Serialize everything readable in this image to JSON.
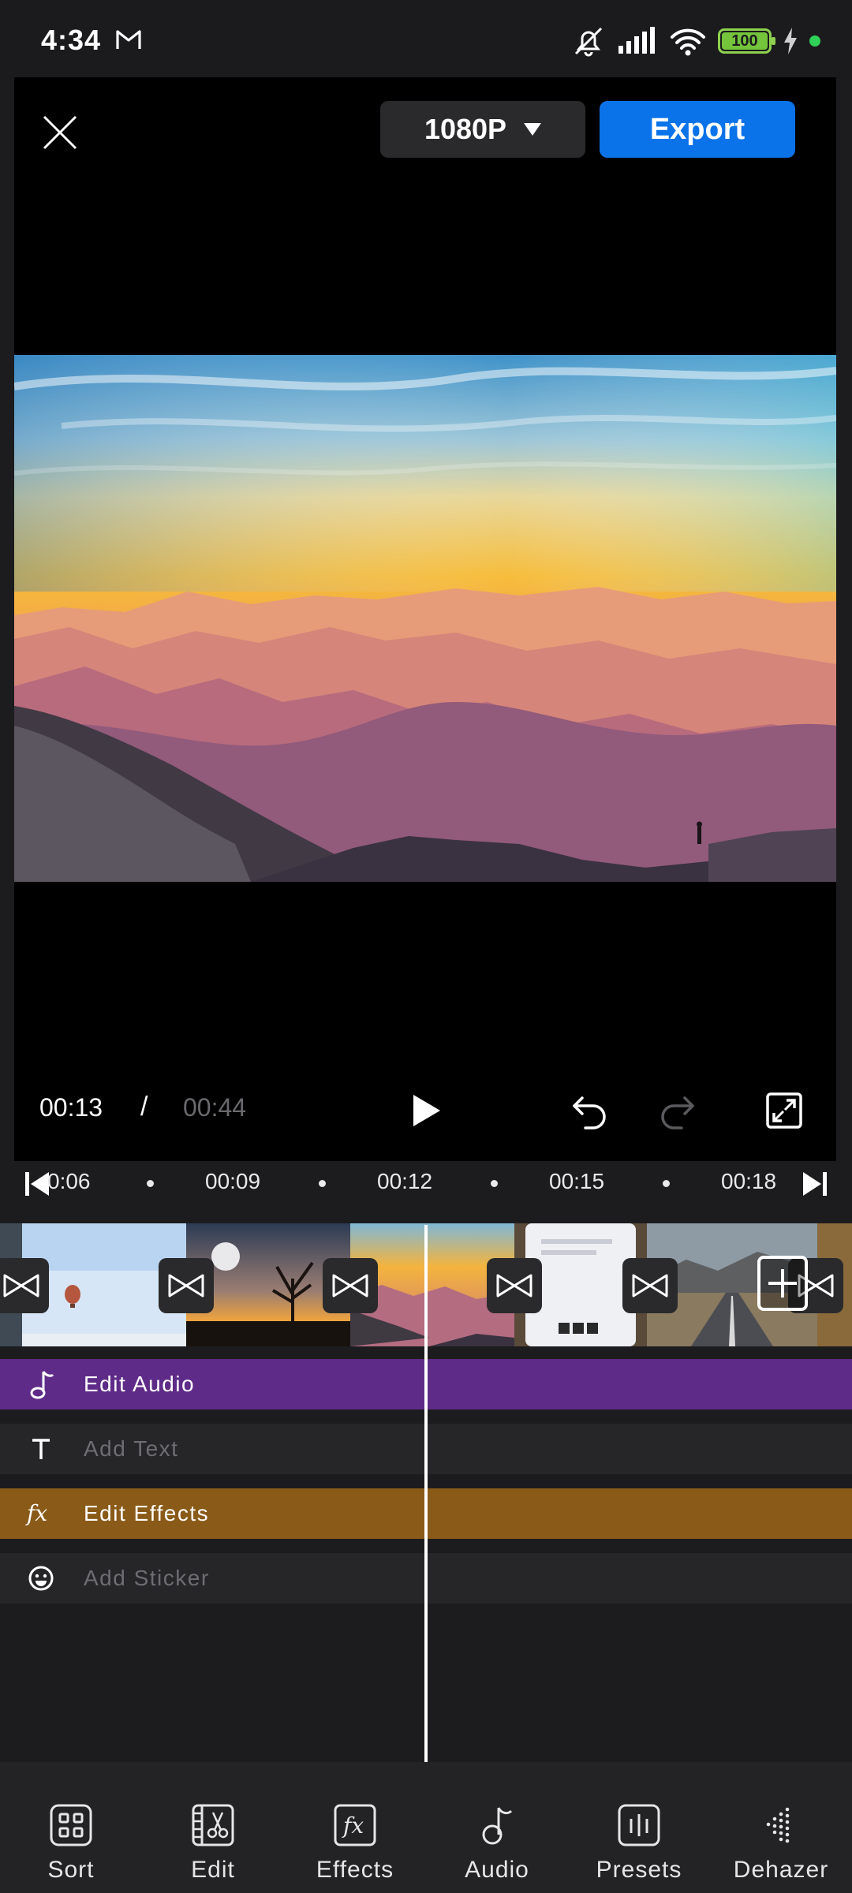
{
  "status_bar": {
    "time": "4:34",
    "battery": "100"
  },
  "preview": {
    "resolution": "1080P",
    "export_label": "Export",
    "current_time": "00:13",
    "separator": "/",
    "total_time": "00:44"
  },
  "ruler": {
    "labels": [
      "0:06",
      "00:09",
      "00:12",
      "00:15",
      "00:18"
    ]
  },
  "tracks": {
    "audio": "Edit Audio",
    "text": "Add Text",
    "effects": "Edit Effects",
    "sticker": "Add Sticker"
  },
  "bottom_nav": {
    "items": [
      {
        "label": "Sort",
        "icon": "sort-grid-icon"
      },
      {
        "label": "Edit",
        "icon": "scissors-icon"
      },
      {
        "label": "Effects",
        "icon": "fx-icon"
      },
      {
        "label": "Audio",
        "icon": "music-note-icon"
      },
      {
        "label": "Presets",
        "icon": "presets-icon"
      },
      {
        "label": "Dehazer",
        "icon": "dehazer-icon"
      }
    ]
  },
  "colors": {
    "accent_blue": "#0a73ea",
    "audio_track": "#5f2b88",
    "effects_track": "#8a5a18",
    "background": "#1c1c1e"
  }
}
